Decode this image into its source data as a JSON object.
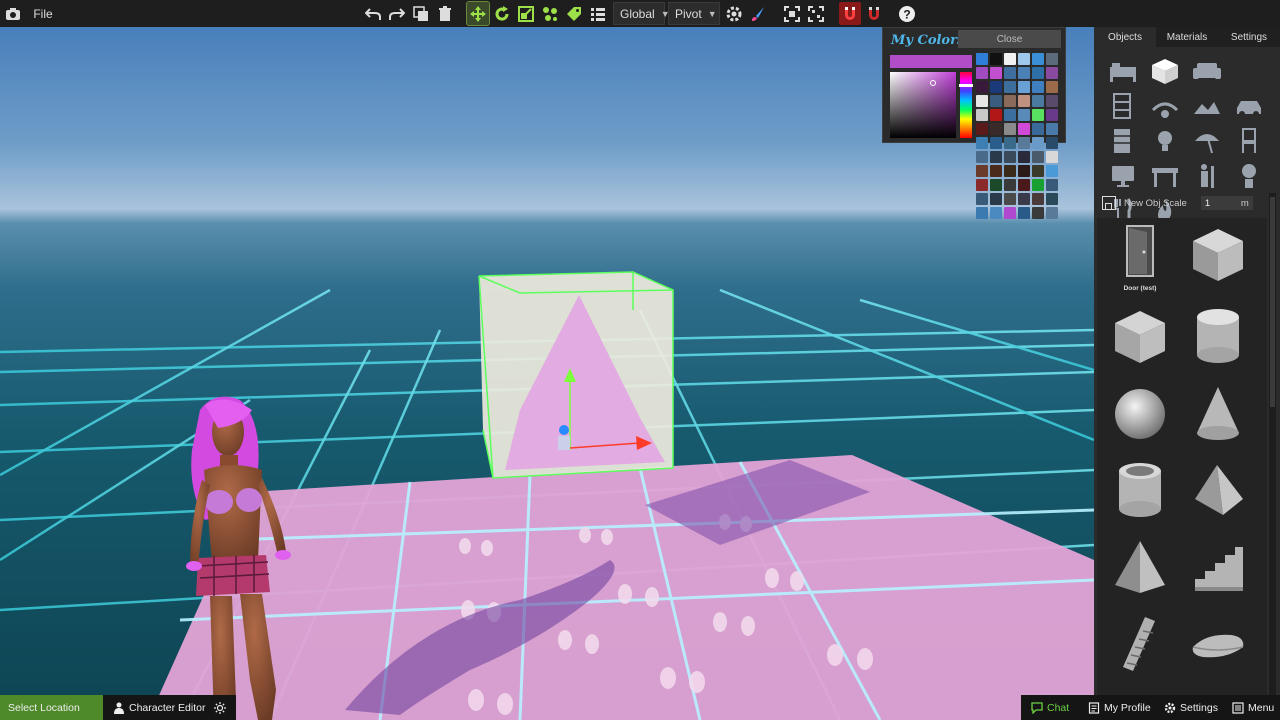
{
  "toolbar": {
    "file_label": "File",
    "space_value": "Global",
    "pivot_value": "Pivot",
    "help_label": "?"
  },
  "color_picker": {
    "title": "My Colors",
    "close_label": "Close",
    "current_color": "#b24dc8",
    "swatches": [
      "#2f7fd8",
      "#111111",
      "#f2f2f2",
      "#9ec8ee",
      "#3b8fd6",
      "#5b6b7b",
      "#a04cc0",
      "#c24ed0",
      "#3f6f9e",
      "#4a7fb8",
      "#2f6fa8",
      "#8a4aa0",
      "#3a1a3a",
      "#1a3a7a",
      "#3c6f9c",
      "#6aa0d8",
      "#3f7fbf",
      "#9a6a4a",
      "#e6e6e6",
      "#3a5c7e",
      "#8a6a5a",
      "#c09080",
      "#4a7aa0",
      "#5a4a6a",
      "#c8c8c8",
      "#b01818",
      "#3a6fa0",
      "#5a8ab8",
      "#58e060",
      "#6a3a8a",
      "#5a1a1a",
      "#3a2a2a",
      "#8a8a8a",
      "#d04ad8",
      "#3a6a9a",
      "#4a7aaa",
      "#3d7fb3",
      "#2a5c8c",
      "#3a6a8a",
      "#5a7a9a",
      "#6a9ac8",
      "#2a4a6a",
      "#4a6a8a",
      "#2a3a4a",
      "#3a4a5a",
      "#2a2a3a",
      "#4a5a6a",
      "#d8d8d8",
      "#6a3a2a",
      "#4a2a1a",
      "#3a2a1a",
      "#2a1a1a",
      "#3a3a2a",
      "#4a9ad8",
      "#8a2a2a",
      "#1a4a2a",
      "#3a3a3a",
      "#4a1a1a",
      "#18a030",
      "#3a5a7a",
      "#3a5a7a",
      "#2a3a4a",
      "#4a4a4a",
      "#3a3a4a",
      "#4a3a3a",
      "#2a4a5a",
      "#3a7ab0",
      "#4a8ac0",
      "#b048d0",
      "#2a5a8a",
      "#3a3a3a",
      "#5a7a9a"
    ]
  },
  "right_panel": {
    "tabs": [
      "Objects",
      "Materials",
      "Settings"
    ],
    "active_tab": "Objects",
    "scale_label": "New Obj Scale",
    "scale_value": "1",
    "scale_unit": "m",
    "objects": [
      {
        "label": "Door (test)",
        "shape": "door"
      }
    ]
  },
  "bottom_left": {
    "select_location": "Select Location",
    "character_editor": "Character Editor"
  },
  "bottom_right": {
    "chat": "Chat",
    "profile": "My Profile",
    "settings": "Settings",
    "menu": "Menu"
  },
  "colors": {
    "accent_green": "#4f8a2a",
    "chat_green": "#6ad040",
    "selection_green": "#5cff5c",
    "floor_pink": "#e6a6d8",
    "grid_cyan": "#4de0ea"
  }
}
